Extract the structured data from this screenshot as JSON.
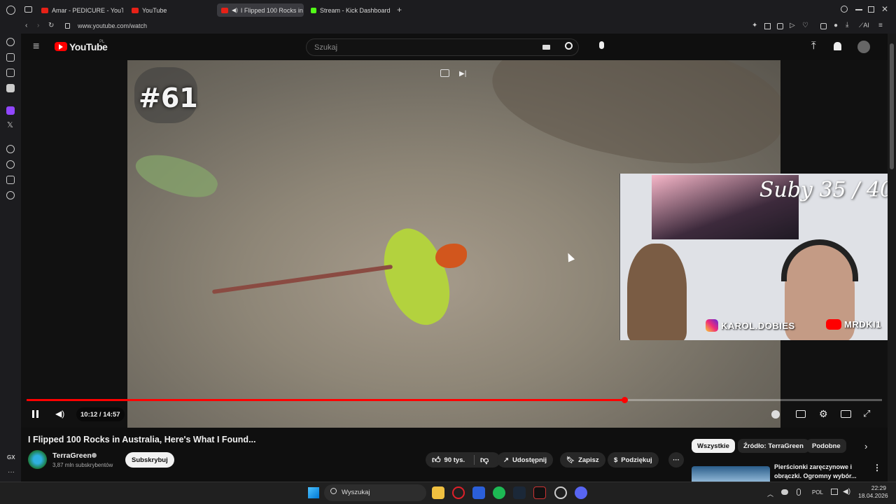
{
  "browser": {
    "tabs": [
      {
        "title": "Amar - PEDICURE - YouTu",
        "favicon": "youtube-icon",
        "active": false
      },
      {
        "title": "YouTube",
        "favicon": "youtube-icon",
        "active": false
      },
      {
        "title": "I Flipped 100 Rocks in",
        "favicon": "youtube-icon",
        "active": true
      },
      {
        "title": "Stream - Kick Dashboard",
        "favicon": "kick-icon",
        "active": false
      }
    ],
    "url": "www.youtube.com/watch",
    "ai_label": "AI"
  },
  "youtube": {
    "logo_text": "YouTube",
    "region": "PL",
    "search_placeholder": "Szukaj"
  },
  "video": {
    "overlay_episode": "#61",
    "progress_fraction": 0.6985,
    "time": "10:12 / 14:57",
    "webcam": {
      "sub_goal": "Suby 35 / 40",
      "instagram": "KAROL.DOBIES",
      "youtube": "MRDKI1"
    }
  },
  "meta": {
    "title": "I Flipped 100 Rocks in Australia, Here's What I Found...",
    "channel": "TerraGreen",
    "subscribers": "3,87 mln subskrybentów",
    "subscribe_label": "Subskrybuj",
    "likes": "90 tys.",
    "share_label": "Udostępnij",
    "save_label": "Zapisz",
    "thanks_label": "Podziękuj"
  },
  "recommend_chips": [
    "Wszystkie",
    "Źródło: TerraGreen",
    "Podobne"
  ],
  "recommend_item": {
    "title_line1": "Pierścionki zaręczynowe i",
    "title_line2": "obrączki. Ogromny wybór..."
  },
  "taskbar": {
    "search_label": "Wyszukaj",
    "lang": "POL",
    "time": "22:29",
    "date": "18.04.2026"
  },
  "colors": {
    "accent_red": "#ff0000",
    "kick_green": "#53fc18"
  }
}
